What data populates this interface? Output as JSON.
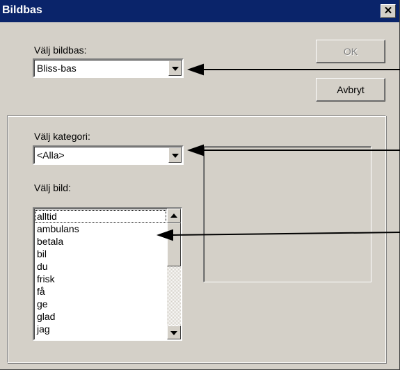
{
  "window": {
    "title": "Bildbas",
    "close_glyph": "✕"
  },
  "imagebase": {
    "label": "Välj bildbas:",
    "selected": "Bliss-bas"
  },
  "buttons": {
    "ok": "OK",
    "cancel": "Avbryt"
  },
  "category": {
    "label": "Välj kategori:",
    "selected": "<Alla>"
  },
  "image": {
    "label": "Välj bild:",
    "items": [
      "alltid",
      "ambulans",
      "betala",
      "bil",
      "du",
      "frisk",
      "få",
      "ge",
      "glad",
      "jag"
    ]
  },
  "icons": {
    "close": "close-icon",
    "dropdown": "chevron-down-icon",
    "scroll_up": "scroll-up-icon",
    "scroll_down": "scroll-down-icon"
  },
  "colors": {
    "titlebar": "#0a246a",
    "face": "#d4d0c8",
    "disabled_text": "#808080"
  }
}
